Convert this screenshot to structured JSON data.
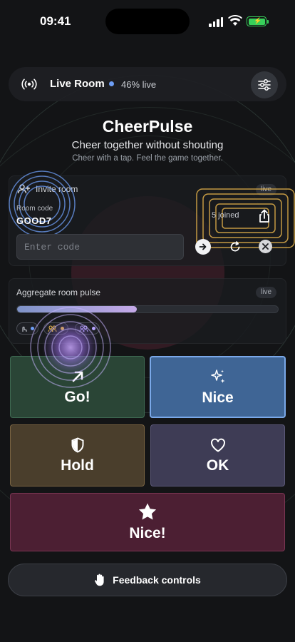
{
  "status_bar": {
    "time": "09:41"
  },
  "top_bar": {
    "title": "Live Room",
    "live_percent": "46% live"
  },
  "hero": {
    "title": "CheerPulse",
    "subtitle": "Cheer together without shouting",
    "tagline": "Cheer with a tap. Feel the game together."
  },
  "invite": {
    "title": "Invite room",
    "badge": "live",
    "code_label": "Room code",
    "code_value": "GOOD7",
    "joined": "5 joined",
    "input_placeholder": "Enter code"
  },
  "aggregate": {
    "title": "Aggregate room pulse",
    "badge": "live",
    "level": 0.46,
    "chips": [
      {
        "icon": "tap-icon",
        "color": "#6e9ef5"
      },
      {
        "icon": "group-icon",
        "color": "#e2b04a"
      },
      {
        "icon": "group-icon",
        "color": "#b7a3ff"
      }
    ]
  },
  "reactions": [
    {
      "label": "Go!",
      "icon": "arrow-up-right-icon"
    },
    {
      "label": "Nice",
      "icon": "sparkle-icon"
    },
    {
      "label": "Hold",
      "icon": "shield-icon"
    },
    {
      "label": "OK",
      "icon": "heart-icon"
    },
    {
      "label": "Nice!",
      "icon": "star-icon"
    }
  ],
  "footer": {
    "feedback_label": "Feedback controls"
  },
  "colors": {
    "background": "#131416",
    "accent_blue": "#6e9ef5",
    "accent_gold": "#e2b04a",
    "go_tile": "#2a4536",
    "nice_tile": "#3f6595",
    "hold_tile": "#4a3e2c",
    "ok_tile": "#3e3c55",
    "star_tile": "#4c1f33"
  }
}
